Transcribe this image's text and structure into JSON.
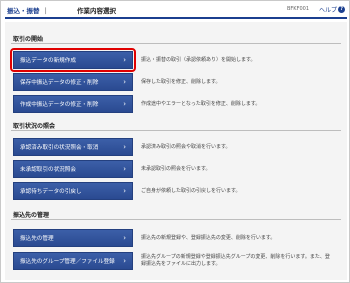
{
  "header": {
    "breadcrumb_primary": "振込・振替",
    "breadcrumb_sep": "｜",
    "page_title": "作業内容選択",
    "screen_id": "BFKF001",
    "help_label": "ヘルプ",
    "help_icon": "?"
  },
  "sections": {
    "s0": {
      "title": "取引の開始",
      "rows": {
        "r0": {
          "label": "振込データの新規作成",
          "desc": "振込・振替の取引（承認依頼あり）を開始します。"
        },
        "r1": {
          "label": "保存中振込データの修正・削除",
          "desc": "保存した取引を修正、削除します。"
        },
        "r2": {
          "label": "作成中振込データの修正・削除",
          "desc": "作成途中やエラーとなった取引を修正、削除します。"
        }
      }
    },
    "s1": {
      "title": "取引状況の照会",
      "rows": {
        "r0": {
          "label": "承認済み取引の状況照会・取消",
          "desc": "承認済み取引の照会や取消を行います。"
        },
        "r1": {
          "label": "未承認取引の状況照会",
          "desc": "未承認取引の照会を行います。"
        },
        "r2": {
          "label": "承認待ちデータの引戻し",
          "desc": "ご自身が依頼した取引の引戻しを行います。"
        }
      }
    },
    "s2": {
      "title": "振込先の管理",
      "rows": {
        "r0": {
          "label": "振込先の管理",
          "desc": "振込先の新規登録や、登録振込先の変更、削除を行います。"
        },
        "r1": {
          "label": "振込先のグループ管理／ファイル登録",
          "desc": "振込先グループの新規登録や登録振込先グループの変更、削除を行います。また、登録振込先をファイルに出力します。"
        }
      }
    }
  },
  "icons": {
    "chevron": "›"
  },
  "colors": {
    "accent": "#1b3f8f",
    "button": "#2f4f96",
    "highlight": "#e00000"
  }
}
